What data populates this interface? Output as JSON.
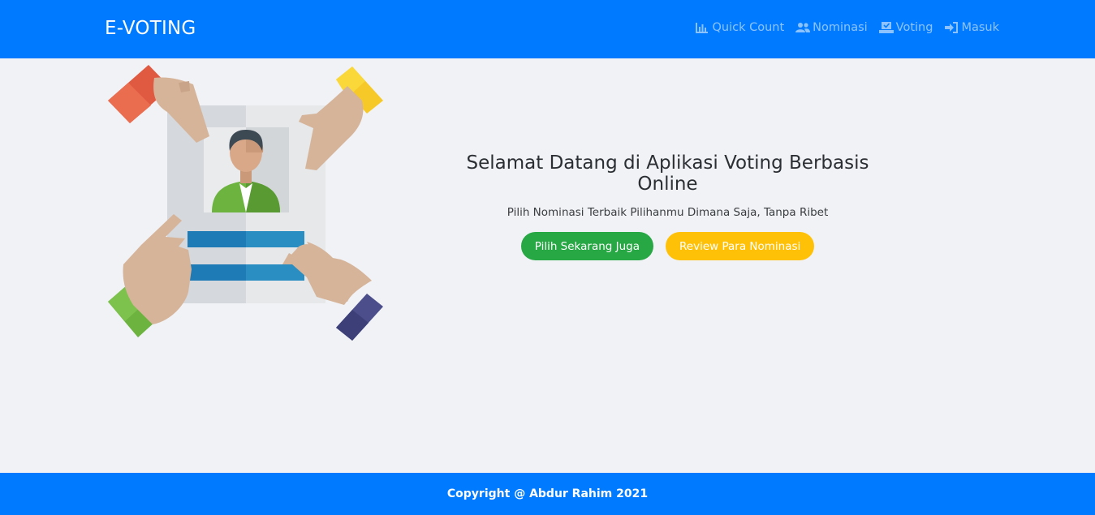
{
  "navbar": {
    "brand": "E-VOTING",
    "links": [
      {
        "label": "Quick Count",
        "icon": "chart-icon"
      },
      {
        "label": "Nominasi",
        "icon": "users-icon"
      },
      {
        "label": "Voting",
        "icon": "vote-icon"
      },
      {
        "label": "Masuk",
        "icon": "sign-in-icon"
      }
    ]
  },
  "hero": {
    "title": "Selamat Datang di Aplikasi Voting Berbasis Online",
    "subtitle": "Pilih Nominasi Terbaik Pilihanmu Dimana Saja, Tanpa Ribet",
    "primary_button": "Pilih Sekarang Juga",
    "secondary_button": "Review Para Nominasi"
  },
  "footer": {
    "copyright": "Copyright @ Abdur Rahim 2021"
  },
  "colors": {
    "primary": "#007bff",
    "success": "#28a745",
    "warning": "#ffc107",
    "background": "#f1f2f6"
  }
}
